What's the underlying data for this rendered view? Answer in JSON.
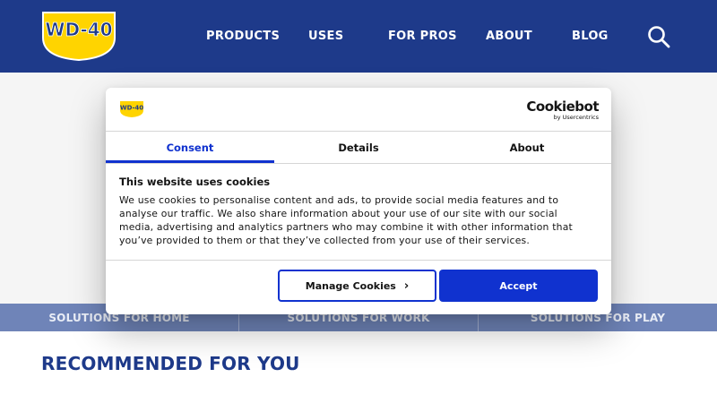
{
  "header": {
    "logo_text": "WD-40",
    "nav": [
      {
        "label": "PRODUCTS"
      },
      {
        "label": "USES"
      },
      {
        "label": "FOR PROS"
      },
      {
        "label": "ABOUT"
      },
      {
        "label": "BLOG"
      }
    ],
    "search_icon": "search-icon"
  },
  "solutions": [
    {
      "label": "SOLUTIONS FOR HOME"
    },
    {
      "label": "SOLUTIONS FOR WORK"
    },
    {
      "label": "SOLUTIONS FOR PLAY"
    }
  ],
  "recommended_heading": "RECOMMENDED FOR YOU",
  "cookie_dialog": {
    "brand": "Cookiebot",
    "brand_sub": "by Usercentrics",
    "tabs": [
      {
        "label": "Consent",
        "active": true
      },
      {
        "label": "Details",
        "active": false
      },
      {
        "label": "About",
        "active": false
      }
    ],
    "title": "This website uses cookies",
    "body": "We use cookies to personalise content and ads, to provide social media features and to analyse our traffic. We also share information about your use of our site with our social media, advertising and analytics partners who may combine it with other information that you’ve provided to them or that they’ve collected from your use of their services.",
    "manage_label": "Manage Cookies",
    "accept_label": "Accept"
  },
  "colors": {
    "brand_blue": "#1e3a8a",
    "accent_blue": "#1032cf",
    "logo_yellow": "#ffd400"
  }
}
